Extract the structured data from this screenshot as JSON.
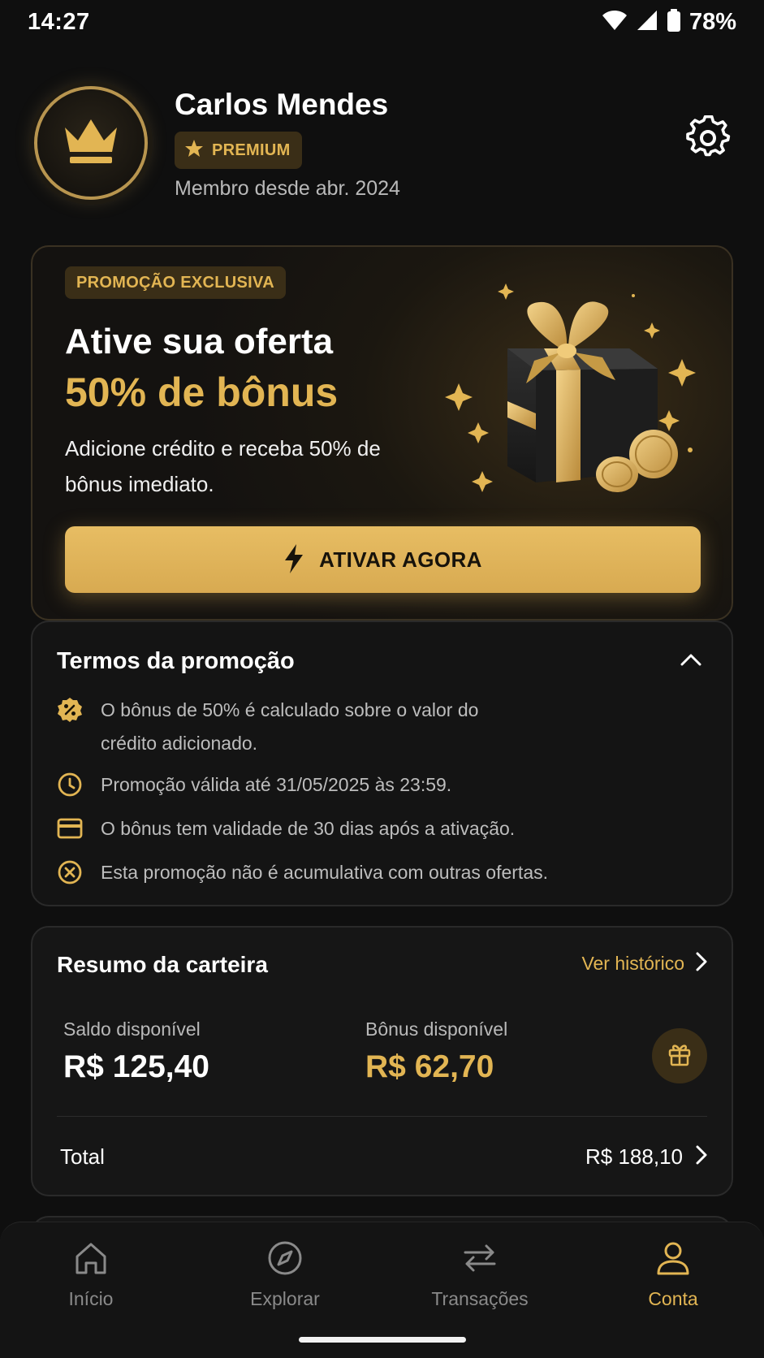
{
  "status_bar": {
    "time": "14:27",
    "battery_pct": "78%",
    "icons": [
      "wifi-icon",
      "signal-icon",
      "battery-icon"
    ]
  },
  "profile": {
    "name": "Carlos Mendes",
    "badge": "PREMIUM",
    "member_since": "Membro desde abr. 2024",
    "avatar_icon": "crown-icon",
    "settings_icon": "gear-icon"
  },
  "promo": {
    "tag": "PROMOÇÃO EXCLUSIVA",
    "title": "Ative sua oferta",
    "bonus": "50% de bônus",
    "description": "Adicione crédito e receba 50% de bônus imediato.",
    "button_label": "ATIVAR AGORA",
    "button_icon": "lightning-icon",
    "illustration": "gift-box-with-coins"
  },
  "terms": {
    "title": "Termos da promoção",
    "items": [
      {
        "icon": "percent-icon",
        "text": "O bônus de 50% é calculado sobre o valor do crédito adicionado."
      },
      {
        "icon": "clock-icon",
        "text": "Promoção válida até 31/05/2025 às 23:59."
      },
      {
        "icon": "card-icon",
        "text": "O bônus tem validade de 30 dias após a ativação."
      },
      {
        "icon": "close-circle-icon",
        "text": "Esta promoção não é acumulativa com outras ofertas."
      }
    ]
  },
  "wallet": {
    "title": "Resumo da carteira",
    "history_link": "Ver histórico",
    "balance_label": "Saldo disponível",
    "balance_value": "R$ 125,40",
    "bonus_label": "Bônus disponível",
    "bonus_value": "R$ 62,70",
    "total_label": "Total",
    "total_value": "R$ 188,10"
  },
  "nav": {
    "items": [
      {
        "label": "Início",
        "icon": "home-icon",
        "active": false
      },
      {
        "label": "Explorar",
        "icon": "compass-icon",
        "active": false
      },
      {
        "label": "Transações",
        "icon": "transfer-icon",
        "active": false
      },
      {
        "label": "Conta",
        "icon": "user-icon",
        "active": true
      }
    ]
  },
  "colors": {
    "background": "#0f0f0f",
    "accent_gold": "#e2b553",
    "card": "#161616",
    "muted_text": "#b9b9b9"
  }
}
